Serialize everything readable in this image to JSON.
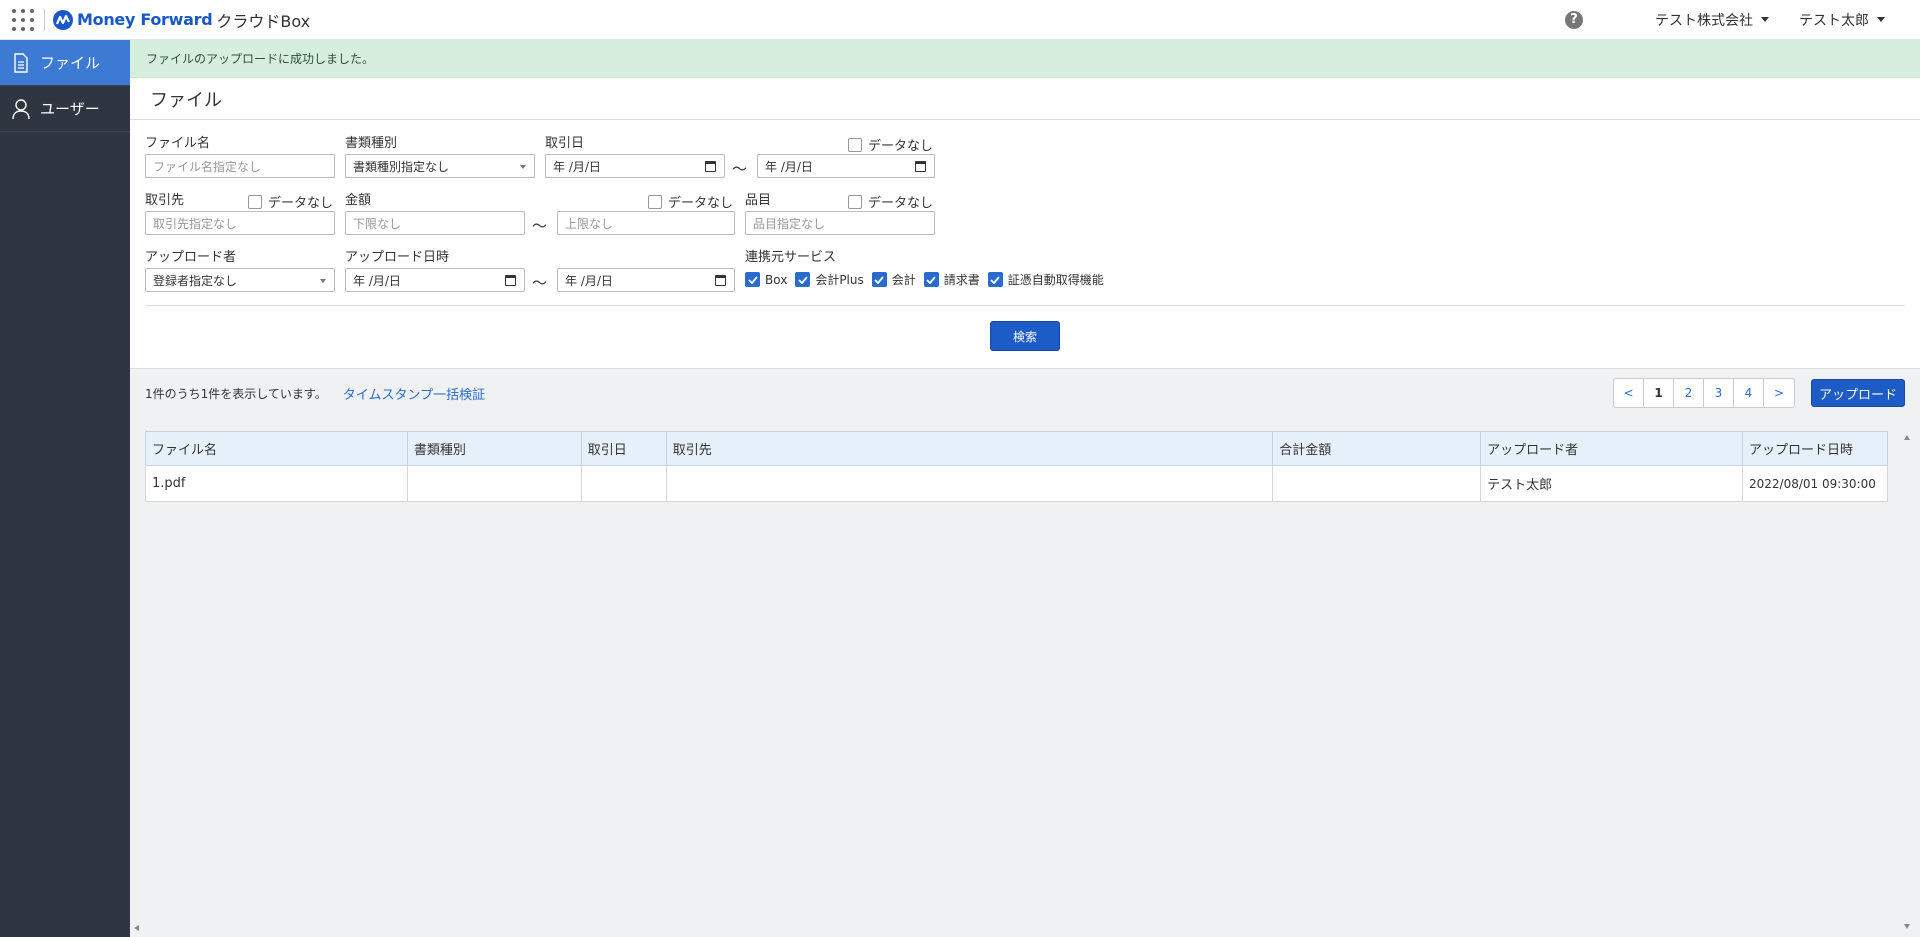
{
  "header": {
    "brand": "Money Forward",
    "product": "クラウドBox",
    "help": "?",
    "company": "テスト株式会社",
    "user": "テスト太郎"
  },
  "sidebar": {
    "items": [
      {
        "label": "ファイル",
        "icon": "document-icon",
        "active": true
      },
      {
        "label": "ユーザー",
        "icon": "user-icon",
        "active": false
      }
    ]
  },
  "alert": "ファイルのアップロードに成功しました。",
  "page_title": "ファイル",
  "filters": {
    "file_name": {
      "label": "ファイル名",
      "placeholder": "ファイル名指定なし"
    },
    "doc_type": {
      "label": "書類種別",
      "value": "書類種別指定なし"
    },
    "txn_date": {
      "label": "取引日",
      "from": "年 /月/日",
      "to": "年 /月/日"
    },
    "partner": {
      "label": "取引先",
      "placeholder": "取引先指定なし"
    },
    "amount": {
      "label": "金額",
      "min_placeholder": "下限なし",
      "max_placeholder": "上限なし"
    },
    "item": {
      "label": "品目",
      "placeholder": "品目指定なし"
    },
    "uploader": {
      "label": "アップロード者",
      "value": "登録者指定なし"
    },
    "upload_date": {
      "label": "アップロード日時",
      "from": "年 /月/日",
      "to": "年 /月/日"
    },
    "services": {
      "label": "連携元サービス",
      "options": [
        "Box",
        "会計Plus",
        "会計",
        "請求書",
        "証憑自動取得機能"
      ]
    },
    "nodata_label": "データなし",
    "tilde": "〜"
  },
  "search_button": "検索",
  "results": {
    "count_text": "1件のうち1件を表示しています。",
    "bulk_link": "タイムスタンプ一括検証",
    "pager": [
      "<",
      "1",
      "2",
      "3",
      "4",
      ">"
    ],
    "current_page": "1",
    "upload_button": "アップロード"
  },
  "table": {
    "columns": [
      "ファイル名",
      "書類種別",
      "取引日",
      "取引先",
      "合計金額",
      "アップロード者",
      "アップロード日時"
    ],
    "rows": [
      [
        "1.pdf",
        "",
        "",
        "",
        "",
        "テスト太郎",
        "2022/08/01 09:30:00"
      ]
    ]
  }
}
